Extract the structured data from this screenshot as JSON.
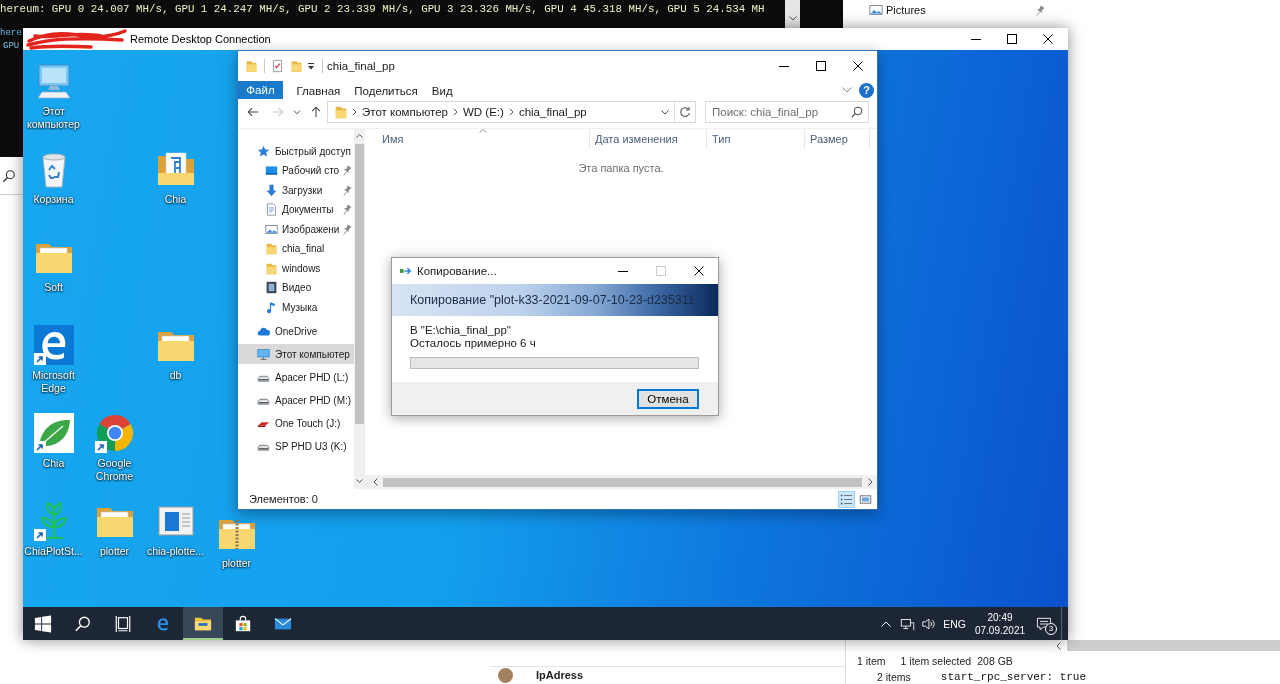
{
  "host": {
    "terminal": {
      "lines": [
        "hereum: GPU 0 24.007 MH/s, GPU 1 24.247 MH/s, GPU 2 23.339 MH/s, GPU 3 23.326 MH/s, GPU 4 45.318 MH/s, GPU 5 24.534 MH",
        "here",
        "GPU"
      ]
    },
    "explorer_nav": [
      {
        "label": "Pictures",
        "kind": "pictures",
        "pinned": true
      }
    ],
    "status_bar": {
      "item_count": "1 item",
      "selection": "1 item selected",
      "size": "208 GB"
    },
    "list_panel": {
      "item_count": "2 items"
    },
    "contact": {
      "name": "IpAdress"
    },
    "config_text": "start_rpc_server: true"
  },
  "remote_desktop": {
    "title": "Remote Desktop Connection",
    "desktop_icons": [
      {
        "label": "Этот компьютер",
        "kind": "computer",
        "shortcut": false,
        "selected": false
      },
      {
        "label": "Корзина",
        "kind": "recycle-bin",
        "shortcut": false,
        "selected": false
      },
      {
        "label": "Chia",
        "kind": "app-folder",
        "shortcut": false,
        "selected": false
      },
      {
        "label": "Soft",
        "kind": "folder",
        "shortcut": false,
        "selected": false
      },
      {
        "label": "Microsoft Edge",
        "kind": "edge",
        "shortcut": true,
        "selected": false
      },
      {
        "label": "db",
        "kind": "folder",
        "shortcut": false,
        "selected": false
      },
      {
        "label": "Chia",
        "kind": "leaf",
        "shortcut": true,
        "selected": false
      },
      {
        "label": "Google Chrome",
        "kind": "chrome",
        "shortcut": true,
        "selected": false
      },
      {
        "label": "ChiaPlotSt...",
        "kind": "plant",
        "shortcut": true,
        "selected": false
      },
      {
        "label": "plotter",
        "kind": "folder",
        "shortcut": false,
        "selected": false
      },
      {
        "label": "chia-plotte...",
        "kind": "app-window",
        "shortcut": false,
        "selected": false
      },
      {
        "label": "plotter",
        "kind": "zip-folder",
        "shortcut": false,
        "selected": false
      }
    ],
    "explorer": {
      "title": "chia_final_pp",
      "ribbon": {
        "tabs": [
          {
            "label": "Файл",
            "kind": "file",
            "selected": false
          },
          {
            "label": "Главная",
            "kind": "tab",
            "selected": false
          },
          {
            "label": "Поделиться",
            "kind": "tab",
            "selected": false
          },
          {
            "label": "Вид",
            "kind": "tab",
            "selected": false
          }
        ],
        "help": "?"
      },
      "nav_buttons": [
        {
          "kind": "back",
          "disabled": false
        },
        {
          "kind": "forward",
          "disabled": true
        },
        {
          "kind": "recent",
          "disabled": false
        },
        {
          "kind": "up",
          "disabled": false
        }
      ],
      "address": [
        "Этот компьютер",
        "WD (E:)",
        "chia_final_pp"
      ],
      "search": {
        "placeholder": "Поиск: chia_final_pp"
      },
      "nav_pane": [
        {
          "label": "Быстрый доступ",
          "kind": "star",
          "selected": false,
          "children": [
            {
              "label": "Рабочий сто",
              "kind": "desktop",
              "pinned": true,
              "selected": false
            },
            {
              "label": "Загрузки",
              "kind": "downloads",
              "pinned": true,
              "selected": false
            },
            {
              "label": "Документы",
              "kind": "documents",
              "pinned": true,
              "selected": false
            },
            {
              "label": "Изображени",
              "kind": "pictures",
              "pinned": true,
              "selected": false
            },
            {
              "label": "chia_final",
              "kind": "folder",
              "pinned": false,
              "selected": false
            },
            {
              "label": "windows",
              "kind": "folder",
              "pinned": false,
              "selected": false
            },
            {
              "label": "Видео",
              "kind": "videos",
              "pinned": false,
              "selected": false
            },
            {
              "label": "Музыка",
              "kind": "music",
              "pinned": false,
              "selected": false
            }
          ]
        },
        {
          "label": "OneDrive",
          "kind": "cloud",
          "selected": false
        },
        {
          "label": "Этот компьютер",
          "kind": "computer",
          "selected": true
        },
        {
          "label": "Apacer PHD (L:)",
          "kind": "drive",
          "selected": false
        },
        {
          "label": "Apacer PHD (M:)",
          "kind": "drive",
          "selected": false
        },
        {
          "label": "One Touch (J:)",
          "kind": "red-drive",
          "selected": false
        },
        {
          "label": "SP PHD U3 (K:)",
          "kind": "drive",
          "selected": false
        }
      ],
      "columns": [
        {
          "label": "Имя",
          "sorted": true
        },
        {
          "label": "Дата изменения",
          "sorted": false
        },
        {
          "label": "Тип",
          "sorted": false
        },
        {
          "label": "Размер",
          "sorted": false
        }
      ],
      "empty_message": "Эта папка пуста.",
      "status": "Элементов: 0",
      "views": [
        {
          "kind": "details",
          "selected": true
        },
        {
          "kind": "large-icons",
          "selected": false
        }
      ]
    },
    "copy_dialog": {
      "title": "Копирование...",
      "maximize_disabled": true,
      "heading": "Копирование \"plot-k33-2021-09-07-10-23-d235311",
      "destination": "В \"E:\\chia_final_pp\"",
      "time_left": "Осталось примерно 6 ч",
      "progress": {
        "level": 0
      },
      "cancel_button": {
        "label": "Отмена",
        "default": true
      }
    },
    "taskbar": {
      "buttons": [
        {
          "kind": "start",
          "active": false
        },
        {
          "kind": "search",
          "active": false
        },
        {
          "kind": "task-view",
          "active": false
        },
        {
          "kind": "edge",
          "active": false
        },
        {
          "kind": "explorer",
          "active": true
        },
        {
          "kind": "store",
          "active": false
        },
        {
          "kind": "mail",
          "active": false
        }
      ],
      "tray": {
        "language": "ENG",
        "time": "20:49",
        "date": "07.09.2021",
        "notification_count": "3"
      }
    }
  }
}
